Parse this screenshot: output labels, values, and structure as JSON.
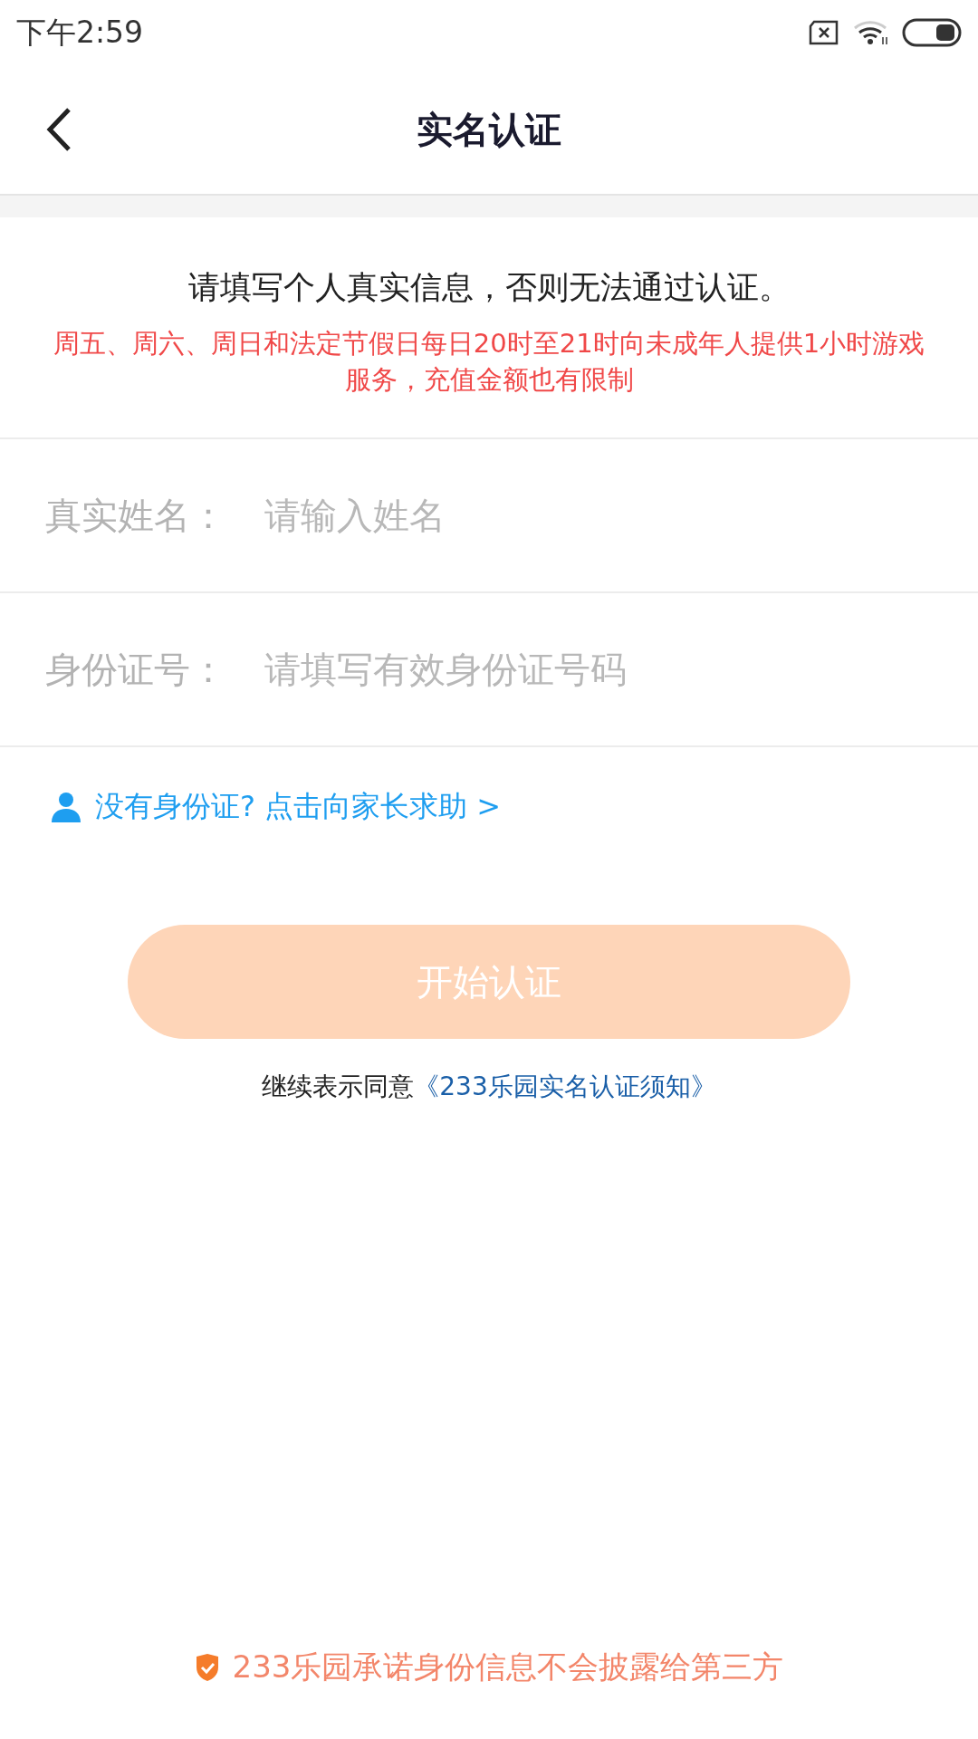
{
  "status_bar": {
    "time": "下午2:59"
  },
  "header": {
    "title": "实名认证"
  },
  "notice": {
    "main": "请填写个人真实信息，否则无法通过认证。",
    "warning": "周五、周六、周日和法定节假日每日20时至21时向未成年人提供1小时游戏服务，充值金额也有限制"
  },
  "fields": [
    {
      "label": "真实姓名：",
      "placeholder": "请输入姓名"
    },
    {
      "label": "身份证号：",
      "placeholder": "请填写有效身份证号码"
    }
  ],
  "help_link": "没有身份证? 点击向家长求助 >",
  "submit_button": {
    "label": "开始认证",
    "disabled": true
  },
  "agreement": {
    "text": "继续表示同意",
    "link": "《233乐园实名认证须知》"
  },
  "footer": "233乐园承诺身份信息不会披露给第三方"
}
